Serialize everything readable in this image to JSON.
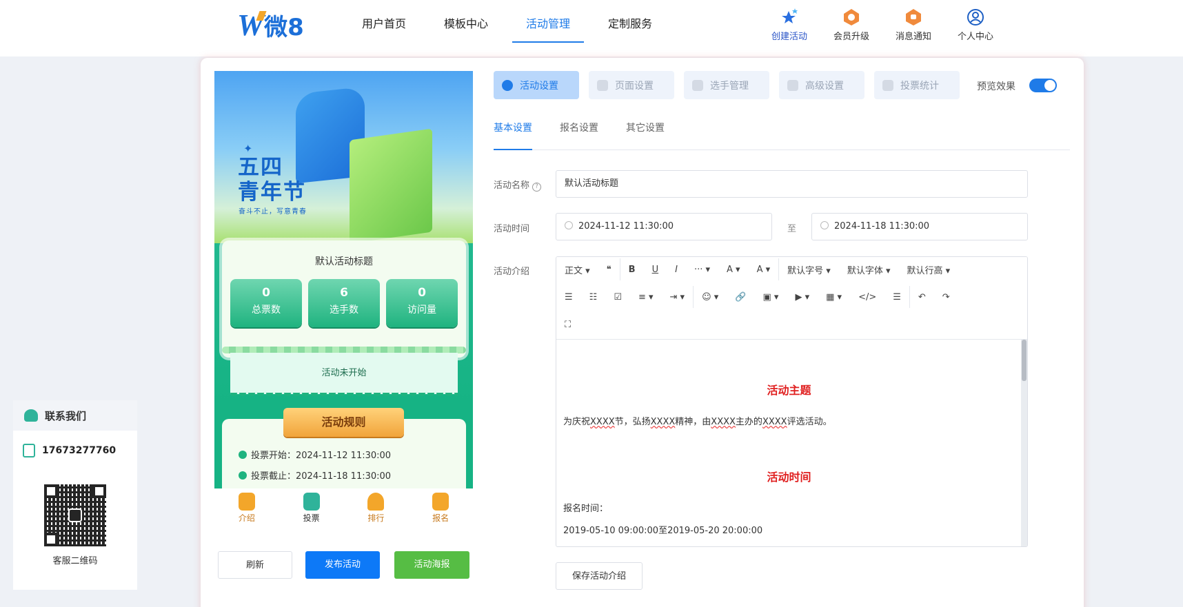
{
  "logo": {
    "text": "W",
    "suffix": "微8"
  },
  "nav": [
    {
      "label": "用户首页"
    },
    {
      "label": "模板中心"
    },
    {
      "label": "活动管理",
      "active": true
    },
    {
      "label": "定制服务"
    }
  ],
  "tools": [
    {
      "label": "创建活动",
      "icon": "stars-icon"
    },
    {
      "label": "会员升级",
      "icon": "vip-icon"
    },
    {
      "label": "消息通知",
      "icon": "bell-icon"
    },
    {
      "label": "个人中心",
      "icon": "user-icon"
    }
  ],
  "phone": {
    "hero_title": [
      "五四",
      "青年节"
    ],
    "hero_subtitle": "奋斗不止，写意青春",
    "activity_title": "默认活动标题",
    "stats": [
      {
        "value": "0",
        "label": "总票数"
      },
      {
        "value": "6",
        "label": "选手数"
      },
      {
        "value": "0",
        "label": "访问量"
      }
    ],
    "status": "活动未开始",
    "rules_title": "活动规则",
    "rules": [
      "投票开始：2024-11-12 11:30:00",
      "投票截止：2024-11-18 11:30:00"
    ],
    "tabbar": [
      {
        "label": "介绍",
        "icon": "intro-icon"
      },
      {
        "label": "投票",
        "icon": "vote-icon"
      },
      {
        "label": "排行",
        "icon": "trophy-icon"
      },
      {
        "label": "报名",
        "icon": "signup-icon"
      }
    ]
  },
  "actions": {
    "refresh": "刷新",
    "publish": "发布活动",
    "poster": "活动海报"
  },
  "settings": {
    "tabs": [
      {
        "label": "活动设置",
        "active": true
      },
      {
        "label": "页面设置"
      },
      {
        "label": "选手管理"
      },
      {
        "label": "高级设置"
      },
      {
        "label": "投票统计"
      }
    ],
    "preview_label": "预览效果",
    "preview_on": true,
    "subtabs": [
      {
        "label": "基本设置",
        "active": true
      },
      {
        "label": "报名设置"
      },
      {
        "label": "其它设置"
      }
    ],
    "name_label": "活动名称",
    "name_value": "默认活动标题",
    "time_label": "活动时间",
    "start_time": "2024-11-12 11:30:00",
    "to": "至",
    "end_time": "2024-11-18 11:30:00",
    "intro_label": "活动介绍",
    "save_intro": "保存活动介绍"
  },
  "editor": {
    "row1": [
      "正文 ▾",
      "❝",
      "B",
      "U",
      "I",
      "··· ▾",
      "A ▾",
      "A ▾",
      "默认字号 ▾",
      "默认字体 ▾",
      "默认行高 ▾"
    ],
    "row2": [
      "☰",
      "☷",
      "☑",
      "≡ ▾",
      "⇥ ▾",
      "☺ ▾",
      "🔗",
      "▣ ▾",
      "▶ ▾",
      "▦ ▾",
      "</>",
      "☰",
      "↶",
      "↷"
    ],
    "row3": [
      "⛶"
    ],
    "h1": "活动主题",
    "p1_pre": "为庆祝",
    "p1_a": "XXXX",
    "p1_b": "节，弘扬",
    "p1_c": "XXXX",
    "p1_d": "精神，由",
    "p1_e": "XXXX",
    "p1_f": "主办的",
    "p1_g": "XXXX",
    "p1_h": "评选活动。",
    "h2": "活动时间",
    "p2": "报名时间：",
    "p3": "2019-05-10 09:00:00至2019-05-20 20:00:00"
  },
  "contact": {
    "title": "联系我们",
    "phone": "17673277760",
    "qr_label": "客服二维码"
  }
}
